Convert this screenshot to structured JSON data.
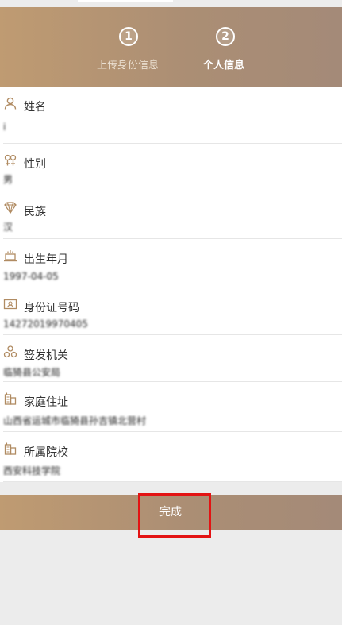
{
  "steps": [
    {
      "number": "1",
      "label": "上传身份信息"
    },
    {
      "number": "2",
      "label": "个人信息"
    }
  ],
  "fields": [
    {
      "label": "姓名",
      "value": "i",
      "icon": "person-icon"
    },
    {
      "label": "性别",
      "value": "男",
      "icon": "gender-icon"
    },
    {
      "label": "民族",
      "value": "汉",
      "icon": "diamond-icon"
    },
    {
      "label": "出生年月",
      "value": "1997-04-05",
      "icon": "cake-icon"
    },
    {
      "label": "身份证号码",
      "value": "14272019970405",
      "icon": "id-card-icon"
    },
    {
      "label": "签发机关",
      "value": "临猗县公安局",
      "icon": "org-icon"
    },
    {
      "label": "家庭住址",
      "value": "山西省运城市临猗县孙吉镇北营村",
      "icon": "building-icon"
    },
    {
      "label": "所属院校",
      "value": "西安科技学院",
      "icon": "building-icon"
    }
  ],
  "done_label": "完成",
  "colors": {
    "accent": "#b2906f",
    "highlight": "#e31313"
  }
}
